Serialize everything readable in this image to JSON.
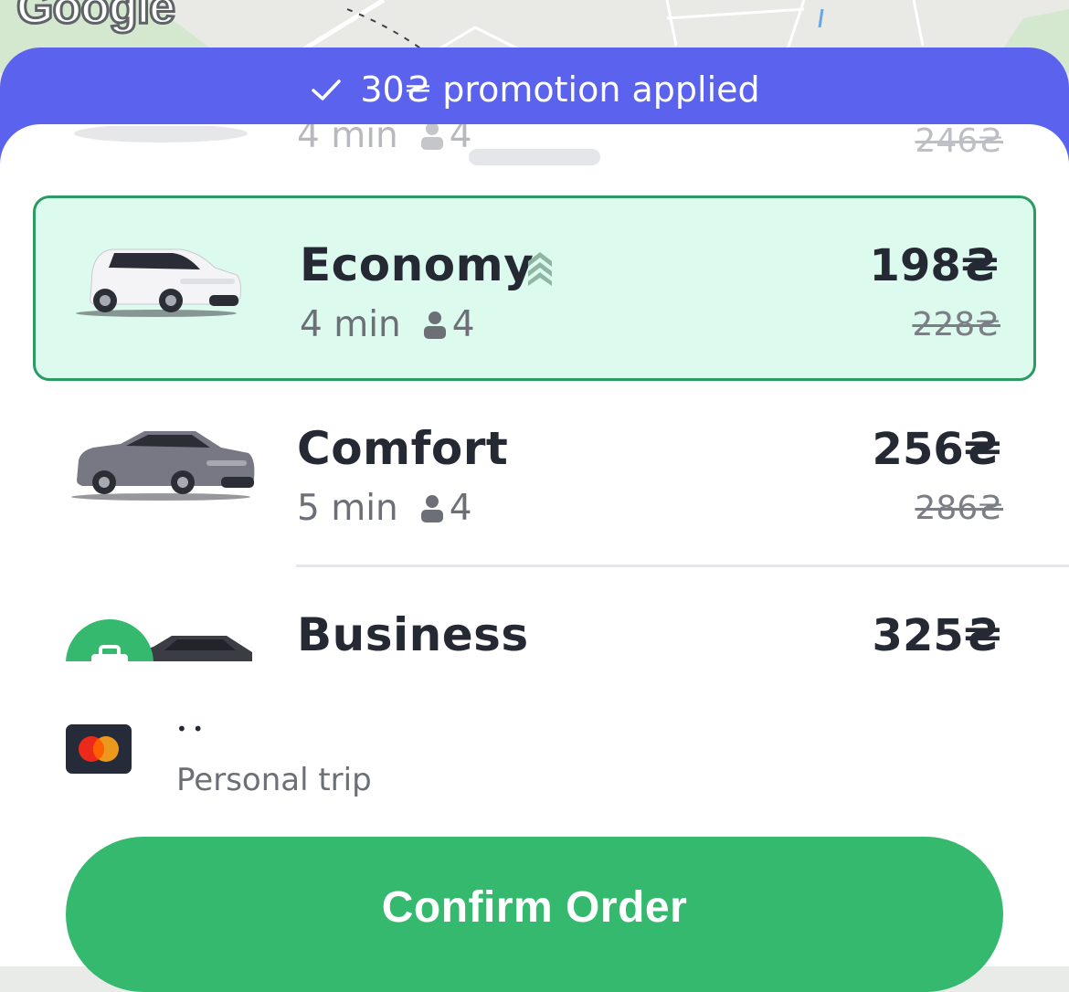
{
  "map": {
    "logo_text": "Google"
  },
  "promo": {
    "icon": "check-icon",
    "text": "30₴ promotion applied"
  },
  "tariffs": [
    {
      "name": "",
      "eta": "4 min",
      "seats": "4",
      "price": "",
      "old_price": "246₴",
      "selected": false,
      "partially_hidden": true
    },
    {
      "name": "Economy",
      "eta": "4 min",
      "seats": "4",
      "price": "198₴",
      "old_price": "228₴",
      "selected": true,
      "badge_icon": "boost-chevrons-icon",
      "car_color": "#ffffff"
    },
    {
      "name": "Comfort",
      "eta": "5 min",
      "seats": "4",
      "price": "256₴",
      "old_price": "286₴",
      "selected": false,
      "car_color": "#74747f"
    },
    {
      "name": "Business",
      "price": "325₴",
      "selected": false,
      "badge_icon": "briefcase-icon",
      "car_color": "#3b3d44",
      "partially_hidden": true
    }
  ],
  "payment": {
    "card_icon": "mastercard-icon",
    "name": "••",
    "subtitle": "Personal trip"
  },
  "confirm": {
    "label": "Confirm Order"
  },
  "colors": {
    "promo_bg": "#5b63ee",
    "selected_bg": "#dcfaee",
    "selected_border": "#2b9a63",
    "confirm_bg": "#34b96e",
    "text_dark": "#252934",
    "text_muted": "#6c6f76"
  }
}
